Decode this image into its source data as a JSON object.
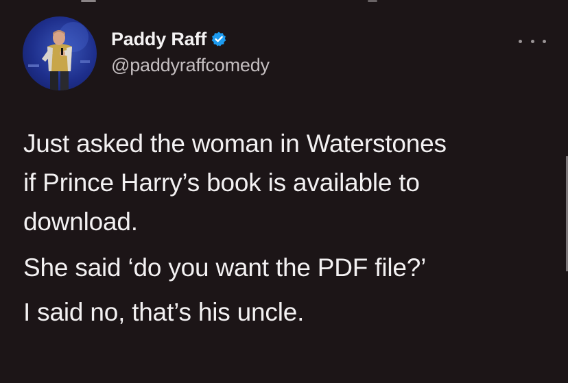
{
  "tweet": {
    "author": {
      "name": "Paddy Raff",
      "handle": "@paddyraffcomedy",
      "verified": true,
      "avatar_icon": "comedian-on-stage-avatar"
    },
    "menu_icon": "more-options-icon",
    "text_lines": [
      "Just asked the woman in Waterstones",
      "if Prince Harry’s book is available to",
      "download.",
      "She said ‘do you want the PDF file?’",
      "I said no, that’s his uncle."
    ]
  },
  "colors": {
    "background": "#1c1517",
    "text": "#f3f1f2",
    "secondary_text": "#c4bec0",
    "verified_badge": "#1d9bf0"
  }
}
